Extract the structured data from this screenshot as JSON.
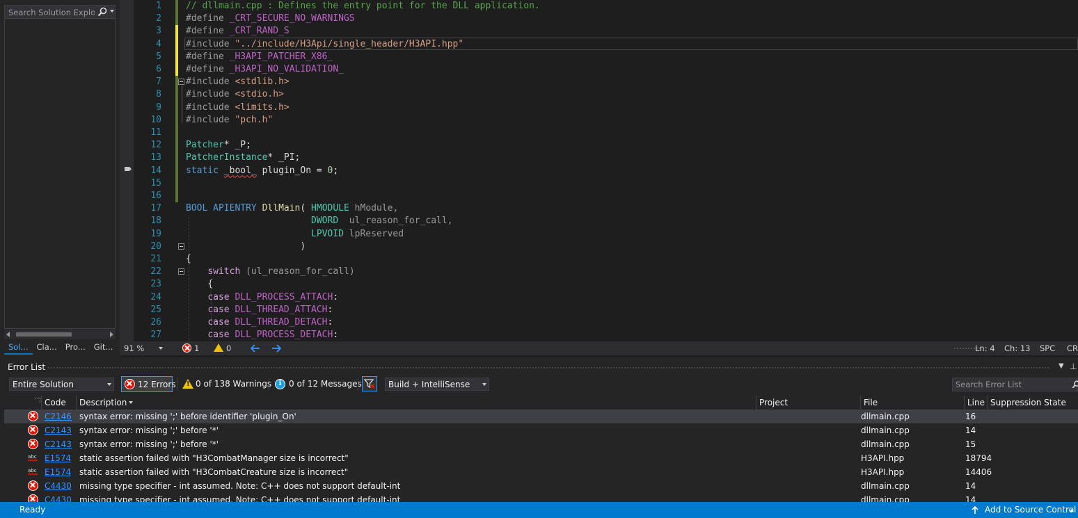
{
  "solution_explorer": {
    "search_placeholder": "Search Solution Explorer",
    "tabs": [
      "Sol...",
      "Cla...",
      "Pro...",
      "Git..."
    ]
  },
  "editor": {
    "lines": [
      {
        "n": "1"
      },
      {
        "n": "2"
      },
      {
        "n": "3"
      },
      {
        "n": "4"
      },
      {
        "n": "5"
      },
      {
        "n": "6"
      },
      {
        "n": "7"
      },
      {
        "n": "8"
      },
      {
        "n": "9"
      },
      {
        "n": "10"
      },
      {
        "n": "11"
      },
      {
        "n": "12"
      },
      {
        "n": "13"
      },
      {
        "n": "14"
      },
      {
        "n": "15"
      },
      {
        "n": "16"
      },
      {
        "n": "17"
      },
      {
        "n": "18"
      },
      {
        "n": "19"
      },
      {
        "n": "20"
      },
      {
        "n": "21"
      },
      {
        "n": "22"
      },
      {
        "n": "23"
      },
      {
        "n": "24"
      },
      {
        "n": "25"
      },
      {
        "n": "26"
      },
      {
        "n": "27"
      }
    ],
    "code": {
      "l1": "// dllmain.cpp : Defines the entry point for the DLL application.",
      "define": "#define",
      "include": "#include",
      "l2_macro": "_CRT_SECURE_NO_WARNINGS",
      "l3_macro": "_CRT_RAND_S",
      "l4_path": "\"../include/H3Api/single_header/H3API.hpp\"",
      "l5_macro": "_H3API_PATCHER_X86_",
      "l6_macro": "_H3API_NO_VALIDATION_",
      "l7_path": "<stdlib.h>",
      "l8_path": "<stdio.h>",
      "l9_path": "<limits.h>",
      "l10_path": "\"pch.h\"",
      "l12_type": "Patcher",
      "l12_rest": "* _P;",
      "l13_type": "PatcherInstance",
      "l13_rest": "* _PI;",
      "l14_kw": "static",
      "l14_type": "_bool_",
      "l14_rest": " plugin_On = ",
      "l14_num": "0",
      "l14_end": ";",
      "l17_a": "BOOL",
      "l17_b": "APIENTRY",
      "l17_c": "DllMain",
      "l17_d": "( ",
      "l17_e": "HMODULE",
      "l17_f": " hModule,",
      "l18_a": "DWORD",
      "l18_b": "  ul_reason_for_call,",
      "l19_a": "LPVOID",
      "l19_b": " lpReserved",
      "l20": ")",
      "l21": "{",
      "l22_kw": "switch",
      "l22_rest": " (ul_reason_for_call)",
      "l23": "{",
      "case_kw": "case",
      "l24": "DLL_PROCESS_ATTACH",
      "l25": "DLL_THREAD_ATTACH",
      "l26": "DLL_THREAD_DETACH",
      "l27": "DLL_PROCESS_DETACH",
      "colon": ":"
    }
  },
  "editor_status": {
    "zoom": "91 %",
    "errors": "1",
    "warnings": "0",
    "ln": "Ln: 4",
    "ch": "Ch: 13",
    "spc": "SPC",
    "crlf": "CRLF"
  },
  "error_list": {
    "title": "Error List",
    "scope": "Entire Solution",
    "errors_btn": "12 Errors",
    "warnings_btn": "0 of 138 Warnings",
    "messages_btn": "0 of 12 Messages",
    "build_filter": "Build + IntelliSense",
    "search_placeholder": "Search Error List",
    "columns": {
      "code": "Code",
      "description": "Description",
      "project": "Project",
      "file": "File",
      "line": "Line",
      "suppression": "Suppression State"
    },
    "rows": [
      {
        "kind": "error",
        "code": "C2146",
        "description": "syntax error: missing ';' before identifier 'plugin_On'",
        "project": "",
        "file": "dllmain.cpp",
        "line": "16"
      },
      {
        "kind": "error",
        "code": "C2143",
        "description": "syntax error: missing ';' before '*'",
        "project": "",
        "file": "dllmain.cpp",
        "line": "14"
      },
      {
        "kind": "error",
        "code": "C2143",
        "description": "syntax error: missing ';' before '*'",
        "project": "",
        "file": "dllmain.cpp",
        "line": "15"
      },
      {
        "kind": "intellisense",
        "code": "E1574",
        "description": "static assertion failed with \"H3CombatManager size is incorrect\"",
        "project": "",
        "file": "H3API.hpp",
        "line": "18794"
      },
      {
        "kind": "intellisense",
        "code": "E1574",
        "description": "static assertion failed with \"H3CombatCreature size is incorrect\"",
        "project": "",
        "file": "H3API.hpp",
        "line": "14406"
      },
      {
        "kind": "error",
        "code": "C4430",
        "description": "missing type specifier - int assumed. Note: C++ does not support default-int",
        "project": "",
        "file": "dllmain.cpp",
        "line": "14"
      },
      {
        "kind": "error",
        "code": "C4430",
        "description": "missing type specifier - int assumed. Note: C++ does not support default-int",
        "project": "",
        "file": "dllmain.cpp",
        "line": "14"
      }
    ]
  },
  "statusbar": {
    "ready": "Ready",
    "source_control": "Add to Source Control"
  },
  "colors": {
    "accent": "#007acc",
    "error": "#e51400",
    "warning": "#f0c300",
    "info": "#1ba1e2",
    "link": "#3794ff"
  }
}
